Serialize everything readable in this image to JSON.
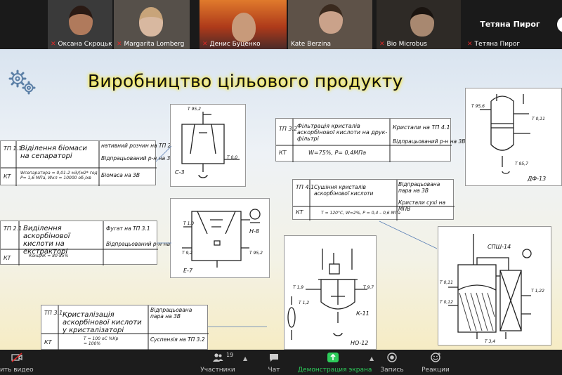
{
  "participants": [
    {
      "name": "Оксана Скроцька"
    },
    {
      "name": "Margarita Lomberg"
    },
    {
      "name": "Денис Буценко"
    },
    {
      "name": "Kate Berzina"
    },
    {
      "name": "Bio Microbus"
    },
    {
      "name": "Тетяна Пирог",
      "display": "Тетяна Пирог"
    }
  ],
  "slide": {
    "title": "Виробництво цільового продукту",
    "boxes": [
      {
        "code": "ТП 1.1",
        "code2": "КТ",
        "name": "Віділення біомаси на сепараторі",
        "params": "Wсепаратора = 0,01-2 м3/(м2* год  Р= 1,6 МПа, Wкл = 10000 об./хв",
        "outputs": [
          "нативний розчин на ТП 2.1",
          "Відпрацьований р-н на 3В",
          "Біомаса на 3В"
        ]
      },
      {
        "code": "ТП 2.1",
        "code2": "КТ",
        "name": "Виділення аскорбінової кислоти на екстракторі",
        "params": "КонцАК = 80-85%",
        "outputs": [
          "Фугат на ТП 3.1",
          "Відпрацьований р-н на 3В"
        ]
      },
      {
        "code": "ТП 3.1",
        "code2": "КТ",
        "name": "Кристалізація аскорбінової кислоти у кристалізаторі",
        "params": "Т = 100 оС  %Кр = 100%",
        "outputs": [
          "Відпрацьована пара на 3В",
          "Суспензія на ТП 3.2"
        ]
      },
      {
        "code": "ТП 3.2",
        "code2": "КТ",
        "name": "Фільтрація кристалів аскорбінової кислоти на друк-фільтрі",
        "params": "W=75%, Р= 0,4МПа",
        "outputs": [
          "Кристали на ТП 4.1",
          "Відпрацьований р-н на 3В"
        ]
      },
      {
        "code": "ТП 4.1",
        "code2": "КТ",
        "name": "Сушіння кристалів аскорбінової кислоти",
        "params": "Т = 120°С, W=2%, Р = 0,4 – 0,6 МПа",
        "outputs": [
          "Відпрацьована пара на 3В",
          "Кристали сухі на МПВ"
        ]
      }
    ],
    "diagrams": {
      "separator": {
        "label": "С-3",
        "ports": [
          "Т 95,2",
          "Т 0,0"
        ]
      },
      "extractor": {
        "label": "Е-7",
        "label2": "Н-8",
        "ports": [
          "Т 1,0",
          "Т 9,2",
          "Т 95,2"
        ]
      },
      "crystallizer": {
        "label": "К-11",
        "label2": "НО-12",
        "ports": [
          "Т 1,9",
          "Т 9,7",
          "Т 1,2"
        ]
      },
      "filter": {
        "label": "ДФ-13",
        "ports": [
          "Т 95,6",
          "Т 0,11",
          "Т 95,7"
        ]
      },
      "dryer": {
        "label": "СПШ-14",
        "ports": [
          "Т 0,11",
          "Т 0,12",
          "Т 1,22",
          "Т 3,4"
        ]
      }
    }
  },
  "toolbar": {
    "video_label": "ить видео",
    "participants_label": "Участники",
    "participants_count": "19",
    "chat_label": "Чат",
    "share_label": "Демонстрация экрана",
    "record_label": "Запись",
    "reactions_label": "Реакции"
  }
}
